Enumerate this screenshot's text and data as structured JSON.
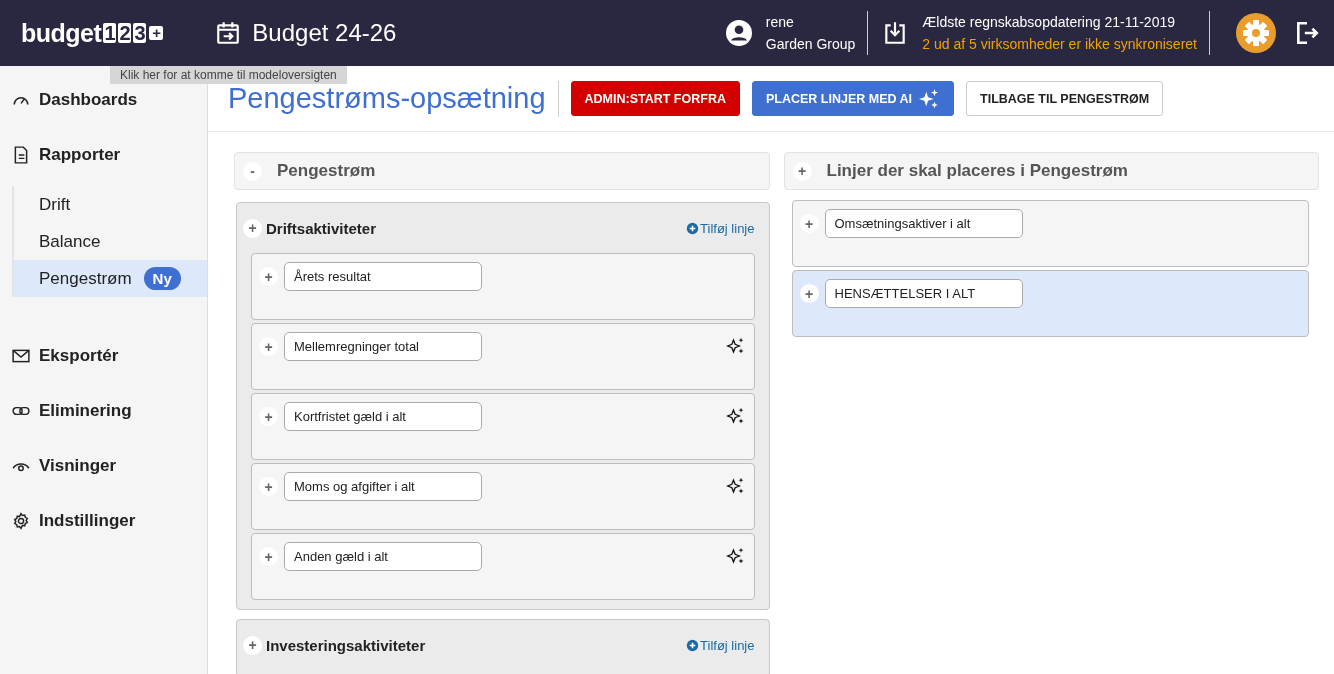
{
  "header": {
    "logo": {
      "word": "budget",
      "digits": [
        "1",
        "2",
        "3"
      ],
      "plus": "+"
    },
    "model": "Budget 24-26",
    "tooltip": "Klik her for at komme til modeloversigten",
    "user": {
      "name": "rene",
      "company": "Garden Group"
    },
    "sync": {
      "title": "Ældste regnskabsopdatering 21-11-2019",
      "warning": "2 ud af 5 virksomheder er ikke synkroniseret"
    }
  },
  "sidebar": {
    "items": [
      {
        "label": "Dashboards",
        "selected": false
      },
      {
        "label": "Rapporter",
        "selected": false,
        "children": [
          {
            "label": "Drift",
            "selected": false
          },
          {
            "label": "Balance",
            "selected": false
          },
          {
            "label": "Pengestrøm",
            "selected": true,
            "badge": "Ny"
          }
        ]
      },
      {
        "label": "Eksportér",
        "selected": false
      },
      {
        "label": "Eliminering",
        "selected": false
      },
      {
        "label": "Visninger",
        "selected": false
      },
      {
        "label": "Indstillinger",
        "selected": false
      }
    ]
  },
  "page": {
    "title": "Pengestrøms-opsætning",
    "buttons": [
      {
        "label": "ADMIN:START FORFRA",
        "kind": "danger"
      },
      {
        "label": "PLACER LINJER MED AI",
        "kind": "ai"
      },
      {
        "label": "TILBAGE TIL PENGESTRØM",
        "kind": "plain"
      }
    ]
  },
  "left_panel": {
    "toggle": "-",
    "title": "Pengestrøm",
    "groups": [
      {
        "toggle": "+",
        "title": "Driftsaktiviteter",
        "add_link": "Tilføj linje",
        "lines": [
          {
            "toggle": "+",
            "label": "Årets resultat",
            "ai_suggested": false
          },
          {
            "toggle": "+",
            "label": "Mellemregninger total",
            "ai_suggested": true
          },
          {
            "toggle": "+",
            "label": "Kortfristet gæld i alt",
            "ai_suggested": true
          },
          {
            "toggle": "+",
            "label": "Moms og afgifter i alt",
            "ai_suggested": true
          },
          {
            "toggle": "+",
            "label": "Anden gæld i alt",
            "ai_suggested": true
          }
        ]
      },
      {
        "toggle": "+",
        "title": "Investeringsaktiviteter",
        "add_link": "Tilføj linje"
      }
    ]
  },
  "right_panel": {
    "toggle": "+",
    "title": "Linjer der skal placeres i Pengestrøm",
    "lines": [
      {
        "toggle": "+",
        "label": "Omsætningsaktiver i alt",
        "selected": false
      },
      {
        "toggle": "+",
        "label": "HENSÆTTELSER I ALT",
        "selected": true
      }
    ]
  }
}
